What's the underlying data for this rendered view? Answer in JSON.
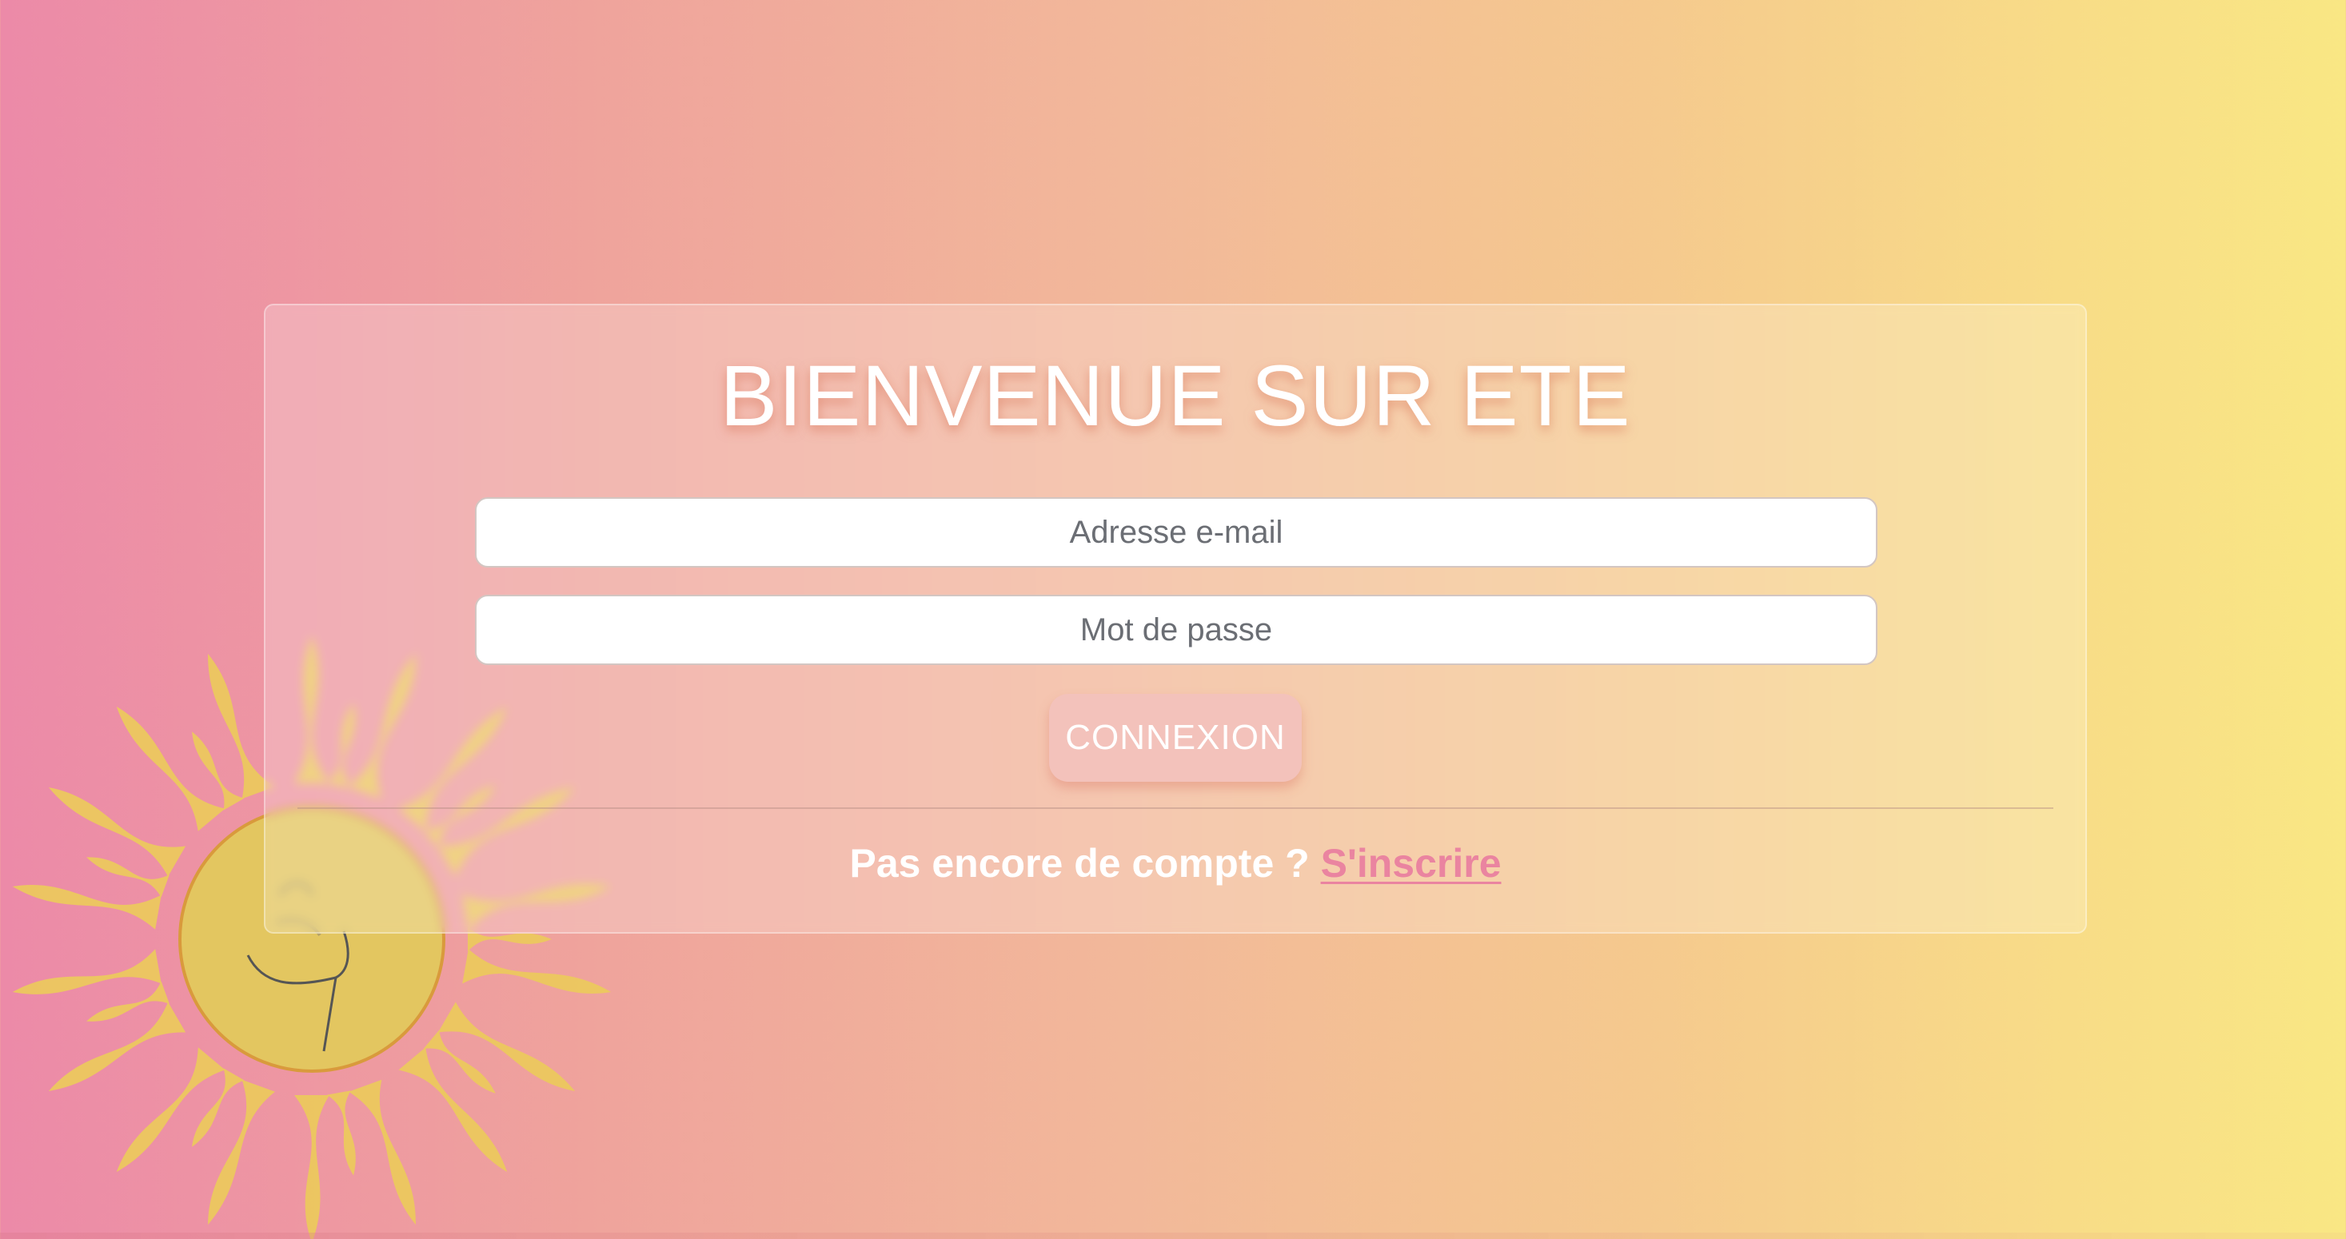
{
  "login": {
    "title": "BIENVENUE SUR ETE",
    "email_placeholder": "Adresse e-mail",
    "password_placeholder": "Mot de passe",
    "submit_label": "CONNEXION",
    "no_account_text": "Pas encore de compte ?",
    "signup_link": "S'inscrire"
  },
  "decoration": {
    "background_gradient": [
      "#ec8aa8",
      "#f2b89a",
      "#f9e784"
    ],
    "sun_icon": "sun-illustration",
    "sun_color": "#ecca5c"
  },
  "colors": {
    "link": "#ea84a0",
    "button_bg": "#f3c2bb",
    "title_text": "#ffffff"
  }
}
